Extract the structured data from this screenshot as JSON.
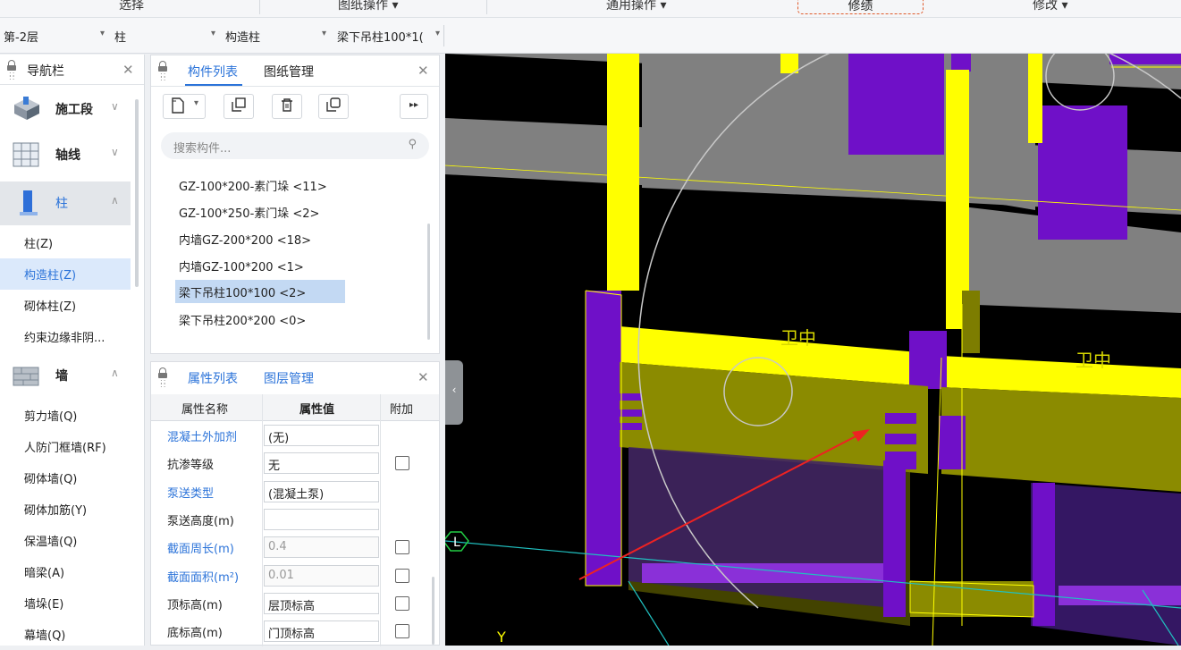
{
  "ribbon": {
    "groups": [
      "选择",
      "图纸操作 ▾",
      "通用操作 ▾",
      "修绩",
      "修改 ▾"
    ]
  },
  "filter": {
    "floor": "第-2层",
    "type": "柱",
    "subtype": "构造柱",
    "component": "梁下吊柱100*1("
  },
  "nav": {
    "title": "导航栏",
    "categories": [
      {
        "label": "施工段",
        "icon": "construction-stage-icon"
      },
      {
        "label": "轴线",
        "icon": "grid-icon"
      },
      {
        "label": "柱",
        "icon": "column-icon"
      },
      {
        "label": "墙",
        "icon": "wall-icon"
      }
    ],
    "column_items": [
      "柱(Z)",
      "构造柱(Z)",
      "砌体柱(Z)",
      "约束边缘非阴..."
    ],
    "wall_items": [
      "剪力墙(Q)",
      "人防门框墙(RF)",
      "砌体墙(Q)",
      "砌体加筋(Y)",
      "保温墙(Q)",
      "暗梁(A)",
      "墙垛(E)",
      "幕墙(Q)"
    ]
  },
  "components": {
    "tab_active": "构件列表",
    "tab_other": "图纸管理",
    "search_placeholder": "搜索构件...",
    "items": [
      "GZ-100*200-素门垛 <11>",
      "GZ-100*250-素门垛 <2>",
      "内墙GZ-200*200 <18>",
      "内墙GZ-100*200 <1>",
      "梁下吊柱100*100 <2>",
      "梁下吊柱200*200 <0>"
    ]
  },
  "props": {
    "tab_active": "属性列表",
    "tab_other": "图层管理",
    "col_name": "属性名称",
    "col_value": "属性值",
    "col_extra": "附加",
    "rows": [
      {
        "name": "混凝土外加剂",
        "value": "(无)"
      },
      {
        "name": "抗渗等级",
        "value": "无"
      },
      {
        "name": "泵送类型",
        "value": "(混凝土泵)"
      },
      {
        "name": "泵送高度(m)",
        "value": ""
      },
      {
        "name": "截面周长(m)",
        "value": "0.4"
      },
      {
        "name": "截面面积(m²)",
        "value": "0.01"
      },
      {
        "name": "顶标高(m)",
        "value": "层顶标高"
      },
      {
        "name": "底标高(m)",
        "value": "门顶标高"
      }
    ]
  },
  "canvas": {
    "label_l": "L",
    "label_y": "Y",
    "marker_text": "卫中"
  }
}
